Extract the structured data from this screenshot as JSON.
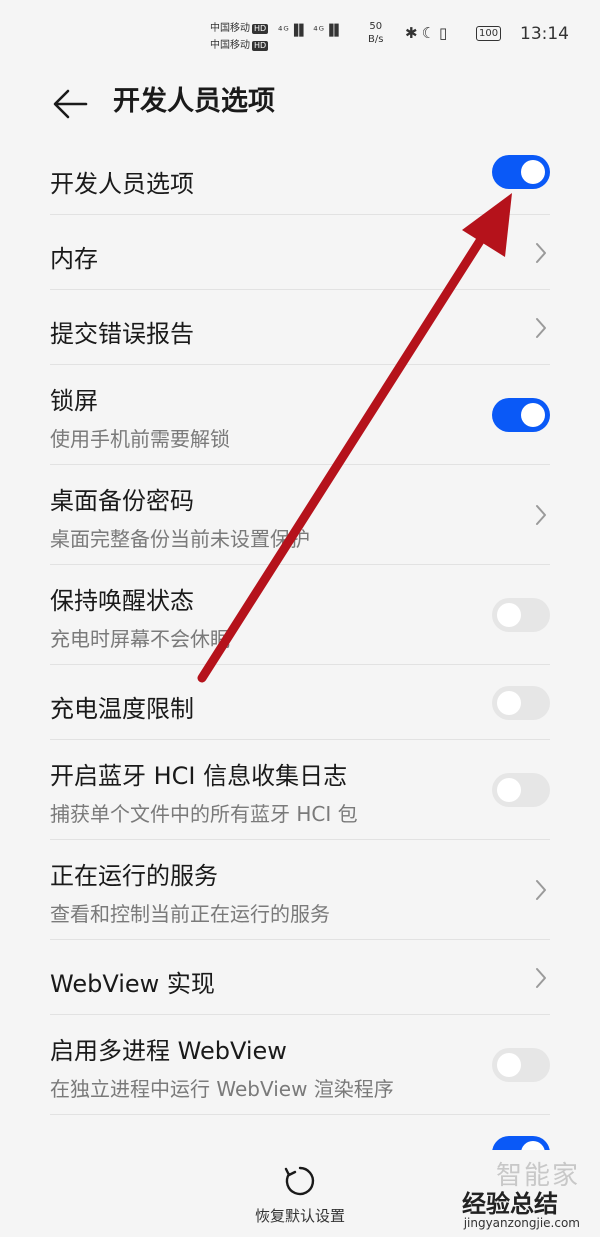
{
  "status_bar": {
    "carrier_1": "中国移动",
    "carrier_2": "中国移动",
    "hd": "HD",
    "signal": "⁴ᴳ▐▌ ⁴ᴳ▐▌",
    "speed_value": "50",
    "speed_unit": "B/s",
    "battery": "100",
    "time": "13:14"
  },
  "header": {
    "title": "开发人员选项"
  },
  "rows": [
    {
      "title": "开发人员选项",
      "subtitle": "",
      "control": "toggle",
      "on": true
    },
    {
      "title": "内存",
      "subtitle": "",
      "control": "chevron"
    },
    {
      "title": "提交错误报告",
      "subtitle": "",
      "control": "chevron"
    },
    {
      "title": "锁屏",
      "subtitle": "使用手机前需要解锁",
      "control": "toggle",
      "on": true
    },
    {
      "title": "桌面备份密码",
      "subtitle": "桌面完整备份当前未设置保护",
      "control": "chevron"
    },
    {
      "title": "保持唤醒状态",
      "subtitle": "充电时屏幕不会休眠",
      "control": "toggle",
      "on": false
    },
    {
      "title": "充电温度限制",
      "subtitle": "",
      "control": "toggle",
      "on": false
    },
    {
      "title": "开启蓝牙 HCI 信息收集日志",
      "subtitle": "捕获单个文件中的所有蓝牙 HCI 包",
      "control": "toggle",
      "on": false
    },
    {
      "title": "正在运行的服务",
      "subtitle": "查看和控制当前正在运行的服务",
      "control": "chevron"
    },
    {
      "title": "WebView 实现",
      "subtitle": "",
      "control": "chevron"
    },
    {
      "title": "启用多进程 WebView",
      "subtitle": "在独立进程中运行 WebView 渲染程序",
      "control": "toggle",
      "on": false
    },
    {
      "title": "",
      "subtitle": "",
      "control": "toggle",
      "on": true
    }
  ],
  "bottom_bar": {
    "reset_label": "恢复默认设置"
  },
  "watermark": {
    "line1": "智能家",
    "line2": "经验总结",
    "line3": "jingyanzongjie.com"
  },
  "colors": {
    "accent": "#0a59f7",
    "arrow": "#b5121b",
    "background": "#f5f5f5"
  }
}
